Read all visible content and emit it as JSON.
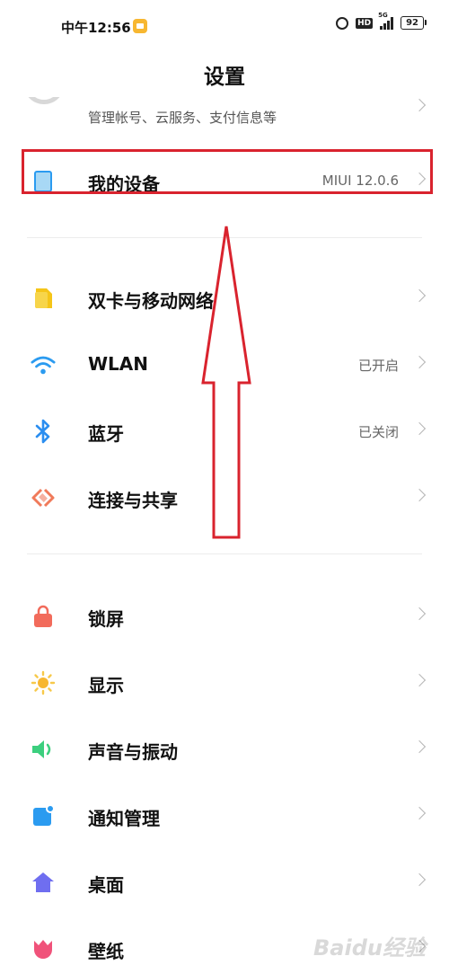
{
  "status_bar": {
    "time": "中午12:56",
    "hd_label": "HD",
    "network_label": "5G",
    "battery": "92"
  },
  "header": {
    "title": "设置"
  },
  "account": {
    "subtitle": "管理帐号、云服务、支付信息等"
  },
  "my_device": {
    "label": "我的设备",
    "value": "MIUI 12.0.6"
  },
  "connectivity": [
    {
      "label": "双卡与移动网络",
      "value": "",
      "icon": "sim-card-icon"
    },
    {
      "label": "WLAN",
      "value": "已开启",
      "icon": "wifi-icon"
    },
    {
      "label": "蓝牙",
      "value": "已关闭",
      "icon": "bluetooth-icon"
    },
    {
      "label": "连接与共享",
      "value": "",
      "icon": "share-icon"
    }
  ],
  "personal": [
    {
      "label": "锁屏",
      "icon": "lock-icon"
    },
    {
      "label": "显示",
      "icon": "sun-icon"
    },
    {
      "label": "声音与振动",
      "icon": "speaker-icon"
    },
    {
      "label": "通知管理",
      "icon": "notification-icon"
    },
    {
      "label": "桌面",
      "icon": "home-icon"
    },
    {
      "label": "壁纸",
      "icon": "tulip-icon"
    }
  ],
  "colors": {
    "highlight": "#d9232e",
    "wifi": "#2b9bf0",
    "bluetooth": "#2b8ef0",
    "sim": "#f5c518",
    "share": "#f07a5a",
    "lock": "#f26b5b",
    "sun": "#f7b731",
    "speaker": "#3ccf7e",
    "notification": "#2b9bf0",
    "home": "#6f6ef0",
    "tulip": "#f0527a"
  },
  "watermark": "Baidu经验"
}
